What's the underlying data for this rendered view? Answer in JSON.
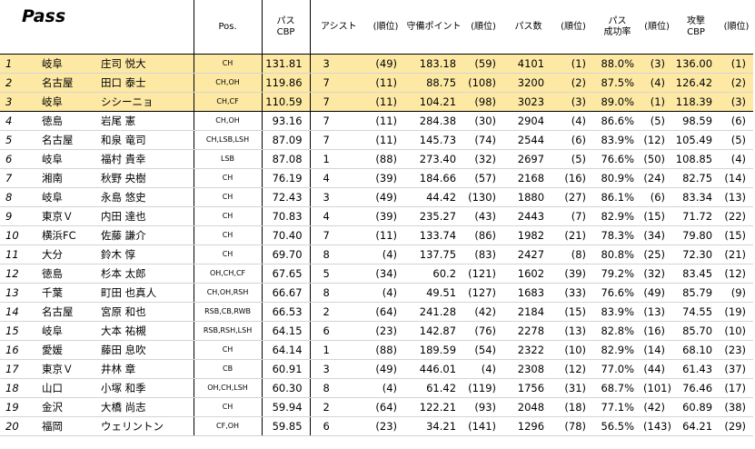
{
  "title": "Pass",
  "headers": {
    "pos": "Pos.",
    "pass_cbp": [
      "パス",
      "CBP"
    ],
    "assist": "アシスト",
    "rank1": "(順位)",
    "defense": "守備ポイント",
    "rank2": "(順位)",
    "passes": "パス数",
    "rank3": "(順位)",
    "success": [
      "パス",
      "成功率"
    ],
    "rank4": "(順位)",
    "attack": [
      "攻撃",
      "CBP"
    ],
    "rank5": "(順位)"
  },
  "highlight_color": "#fde9a4",
  "rows": [
    {
      "rank": "1",
      "team": "岐阜",
      "name": "庄司 悦大",
      "pos": "CH",
      "cbp": "131.81",
      "ast": "3",
      "ast_r": "(49)",
      "def": "183.18",
      "def_r": "(59)",
      "passes": "4101",
      "passes_r": "(1)",
      "succ": "88.0%",
      "succ_r": "(3)",
      "atk": "136.00",
      "atk_r": "(1)",
      "hl": true
    },
    {
      "rank": "2",
      "team": "名古屋",
      "name": "田口 泰士",
      "pos": "CH,OH",
      "cbp": "119.86",
      "ast": "7",
      "ast_r": "(11)",
      "def": "88.75",
      "def_r": "(108)",
      "passes": "3200",
      "passes_r": "(2)",
      "succ": "87.5%",
      "succ_r": "(4)",
      "atk": "126.42",
      "atk_r": "(2)",
      "hl": true
    },
    {
      "rank": "3",
      "team": "岐阜",
      "name": "シシーニョ",
      "pos": "CH,CF",
      "cbp": "110.59",
      "ast": "7",
      "ast_r": "(11)",
      "def": "104.21",
      "def_r": "(98)",
      "passes": "3023",
      "passes_r": "(3)",
      "succ": "89.0%",
      "succ_r": "(1)",
      "atk": "118.39",
      "atk_r": "(3)",
      "hl": true
    },
    {
      "rank": "4",
      "team": "徳島",
      "name": "岩尾 憲",
      "pos": "CH,OH",
      "cbp": "93.16",
      "ast": "7",
      "ast_r": "(11)",
      "def": "284.38",
      "def_r": "(30)",
      "passes": "2904",
      "passes_r": "(4)",
      "succ": "86.6%",
      "succ_r": "(5)",
      "atk": "98.59",
      "atk_r": "(6)",
      "hl": false
    },
    {
      "rank": "5",
      "team": "名古屋",
      "name": "和泉 竜司",
      "pos": "CH,LSB,LSH",
      "cbp": "87.09",
      "ast": "7",
      "ast_r": "(11)",
      "def": "145.73",
      "def_r": "(74)",
      "passes": "2544",
      "passes_r": "(6)",
      "succ": "83.9%",
      "succ_r": "(12)",
      "atk": "105.49",
      "atk_r": "(5)",
      "hl": false
    },
    {
      "rank": "6",
      "team": "岐阜",
      "name": "福村 貴幸",
      "pos": "LSB",
      "cbp": "87.08",
      "ast": "1",
      "ast_r": "(88)",
      "def": "273.40",
      "def_r": "(32)",
      "passes": "2697",
      "passes_r": "(5)",
      "succ": "76.6%",
      "succ_r": "(50)",
      "atk": "108.85",
      "atk_r": "(4)",
      "hl": false
    },
    {
      "rank": "7",
      "team": "湘南",
      "name": "秋野 央樹",
      "pos": "CH",
      "cbp": "76.19",
      "ast": "4",
      "ast_r": "(39)",
      "def": "184.66",
      "def_r": "(57)",
      "passes": "2168",
      "passes_r": "(16)",
      "succ": "80.9%",
      "succ_r": "(24)",
      "atk": "82.75",
      "atk_r": "(14)",
      "hl": false
    },
    {
      "rank": "8",
      "team": "岐阜",
      "name": "永島 悠史",
      "pos": "CH",
      "cbp": "72.43",
      "ast": "3",
      "ast_r": "(49)",
      "def": "44.42",
      "def_r": "(130)",
      "passes": "1880",
      "passes_r": "(27)",
      "succ": "86.1%",
      "succ_r": "(6)",
      "atk": "83.34",
      "atk_r": "(13)",
      "hl": false
    },
    {
      "rank": "9",
      "team": "東京Ｖ",
      "name": "内田 達也",
      "pos": "CH",
      "cbp": "70.83",
      "ast": "4",
      "ast_r": "(39)",
      "def": "235.27",
      "def_r": "(43)",
      "passes": "2443",
      "passes_r": "(7)",
      "succ": "82.9%",
      "succ_r": "(15)",
      "atk": "71.72",
      "atk_r": "(22)",
      "hl": false
    },
    {
      "rank": "10",
      "team": "横浜FC",
      "name": "佐藤 謙介",
      "pos": "CH",
      "cbp": "70.40",
      "ast": "7",
      "ast_r": "(11)",
      "def": "133.74",
      "def_r": "(86)",
      "passes": "1982",
      "passes_r": "(21)",
      "succ": "78.3%",
      "succ_r": "(34)",
      "atk": "79.80",
      "atk_r": "(15)",
      "hl": false
    },
    {
      "rank": "11",
      "team": "大分",
      "name": "鈴木 惇",
      "pos": "CH",
      "cbp": "69.70",
      "ast": "8",
      "ast_r": "(4)",
      "def": "137.75",
      "def_r": "(83)",
      "passes": "2427",
      "passes_r": "(8)",
      "succ": "80.8%",
      "succ_r": "(25)",
      "atk": "72.30",
      "atk_r": "(21)",
      "hl": false
    },
    {
      "rank": "12",
      "team": "徳島",
      "name": "杉本 太郎",
      "pos": "OH,CH,CF",
      "cbp": "67.65",
      "ast": "5",
      "ast_r": "(34)",
      "def": "60.2",
      "def_r": "(121)",
      "passes": "1602",
      "passes_r": "(39)",
      "succ": "79.2%",
      "succ_r": "(32)",
      "atk": "83.45",
      "atk_r": "(12)",
      "hl": false
    },
    {
      "rank": "13",
      "team": "千葉",
      "name": "町田 也真人",
      "pos": "CH,OH,RSH",
      "cbp": "66.67",
      "ast": "8",
      "ast_r": "(4)",
      "def": "49.51",
      "def_r": "(127)",
      "passes": "1683",
      "passes_r": "(33)",
      "succ": "76.6%",
      "succ_r": "(49)",
      "atk": "85.79",
      "atk_r": "(9)",
      "hl": false
    },
    {
      "rank": "14",
      "team": "名古屋",
      "name": "宮原 和也",
      "pos": "RSB,CB,RWB",
      "cbp": "66.53",
      "ast": "2",
      "ast_r": "(64)",
      "def": "241.28",
      "def_r": "(42)",
      "passes": "2184",
      "passes_r": "(15)",
      "succ": "83.9%",
      "succ_r": "(13)",
      "atk": "74.55",
      "atk_r": "(19)",
      "hl": false
    },
    {
      "rank": "15",
      "team": "岐阜",
      "name": "大本 祐槻",
      "pos": "RSB,RSH,LSH",
      "cbp": "64.15",
      "ast": "6",
      "ast_r": "(23)",
      "def": "142.87",
      "def_r": "(76)",
      "passes": "2278",
      "passes_r": "(13)",
      "succ": "82.8%",
      "succ_r": "(16)",
      "atk": "85.70",
      "atk_r": "(10)",
      "hl": false
    },
    {
      "rank": "16",
      "team": "愛媛",
      "name": "藤田 息吹",
      "pos": "CH",
      "cbp": "64.14",
      "ast": "1",
      "ast_r": "(88)",
      "def": "189.59",
      "def_r": "(54)",
      "passes": "2322",
      "passes_r": "(10)",
      "succ": "82.9%",
      "succ_r": "(14)",
      "atk": "68.10",
      "atk_r": "(23)",
      "hl": false
    },
    {
      "rank": "17",
      "team": "東京Ｖ",
      "name": "井林 章",
      "pos": "CB",
      "cbp": "60.91",
      "ast": "3",
      "ast_r": "(49)",
      "def": "446.01",
      "def_r": "(4)",
      "passes": "2308",
      "passes_r": "(12)",
      "succ": "77.0%",
      "succ_r": "(44)",
      "atk": "61.43",
      "atk_r": "(37)",
      "hl": false
    },
    {
      "rank": "18",
      "team": "山口",
      "name": "小塚 和季",
      "pos": "OH,CH,LSH",
      "cbp": "60.30",
      "ast": "8",
      "ast_r": "(4)",
      "def": "61.42",
      "def_r": "(119)",
      "passes": "1756",
      "passes_r": "(31)",
      "succ": "68.7%",
      "succ_r": "(101)",
      "atk": "76.46",
      "atk_r": "(17)",
      "hl": false
    },
    {
      "rank": "19",
      "team": "金沢",
      "name": "大橋 尚志",
      "pos": "CH",
      "cbp": "59.94",
      "ast": "2",
      "ast_r": "(64)",
      "def": "122.21",
      "def_r": "(93)",
      "passes": "2048",
      "passes_r": "(18)",
      "succ": "77.1%",
      "succ_r": "(42)",
      "atk": "60.89",
      "atk_r": "(38)",
      "hl": false
    },
    {
      "rank": "20",
      "team": "福岡",
      "name": "ウェリントン",
      "pos": "CF,OH",
      "cbp": "59.85",
      "ast": "6",
      "ast_r": "(23)",
      "def": "34.21",
      "def_r": "(141)",
      "passes": "1296",
      "passes_r": "(78)",
      "succ": "56.5%",
      "succ_r": "(143)",
      "atk": "64.21",
      "atk_r": "(29)",
      "hl": false
    }
  ]
}
